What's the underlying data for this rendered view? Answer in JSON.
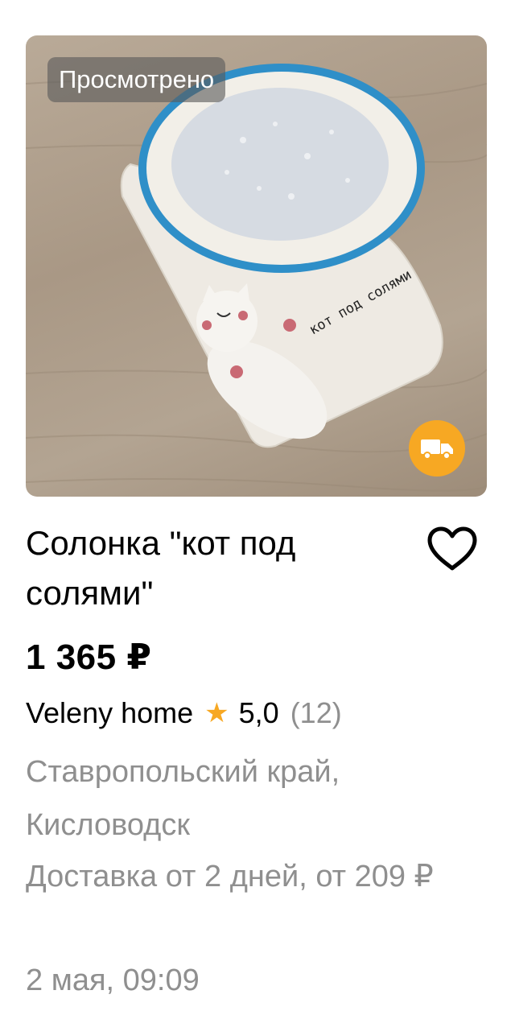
{
  "listing": {
    "viewed_badge": "Просмотрено",
    "image_text": "кот под солями",
    "title": "Солонка \"кот под солями\"",
    "price": "1 365 ₽",
    "seller": {
      "name": "Veleny home",
      "rating": "5,0",
      "reviews": "(12)"
    },
    "location": "Ставропольский край, Кисловодск",
    "delivery": "Доставка от 2 дней, от 209 ₽",
    "date": "2 мая, 09:09"
  },
  "icons": {
    "favorite": "heart-icon",
    "star": "star-icon",
    "delivery": "truck-icon"
  },
  "colors": {
    "accent": "#f7a823",
    "secondary_text": "#8f8f8f",
    "badge_bg": "#5a5a5a"
  }
}
